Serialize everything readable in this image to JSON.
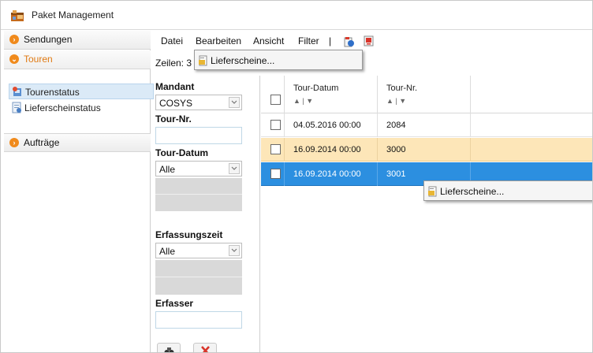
{
  "window": {
    "title": "Paket Management"
  },
  "nav": {
    "sections": [
      {
        "label": "Sendungen"
      },
      {
        "label": "Touren"
      },
      {
        "label": "Aufträge"
      }
    ],
    "items": [
      {
        "label": "Tourenstatus"
      },
      {
        "label": "Lieferscheinstatus"
      }
    ]
  },
  "menubar": {
    "items": [
      "Datei",
      "Bearbeiten",
      "Ansicht",
      "Filter",
      "|"
    ],
    "rows_label": "Zeilen: 3"
  },
  "menu_popup": {
    "item": "Lieferscheine..."
  },
  "context_menu": {
    "item": "Lieferscheine..."
  },
  "filter": {
    "mandant_label": "Mandant",
    "mandant_value": "COSYS",
    "tournr_label": "Tour-Nr.",
    "tourdatum_label": "Tour-Datum",
    "tourdatum_value": "Alle",
    "erfassungszeit_label": "Erfassungszeit",
    "erfassungszeit_value": "Alle",
    "erfasser_label": "Erfasser"
  },
  "table": {
    "columns": [
      "Tour-Datum",
      "Tour-Nr."
    ],
    "sort_glyph": "▲ | ▼",
    "rows": [
      {
        "date": "04.05.2016 00:00",
        "nr": "2084",
        "state": "normal"
      },
      {
        "date": "16.09.2014 00:00",
        "nr": "3000",
        "state": "hover"
      },
      {
        "date": "16.09.2014 00:00",
        "nr": "3001",
        "state": "selected"
      }
    ]
  },
  "colors": {
    "accent_orange": "#f08a1c",
    "nav_selected": "#dbeaf7",
    "row_hover": "#fde6b8",
    "row_selected": "#2c8fe0"
  }
}
